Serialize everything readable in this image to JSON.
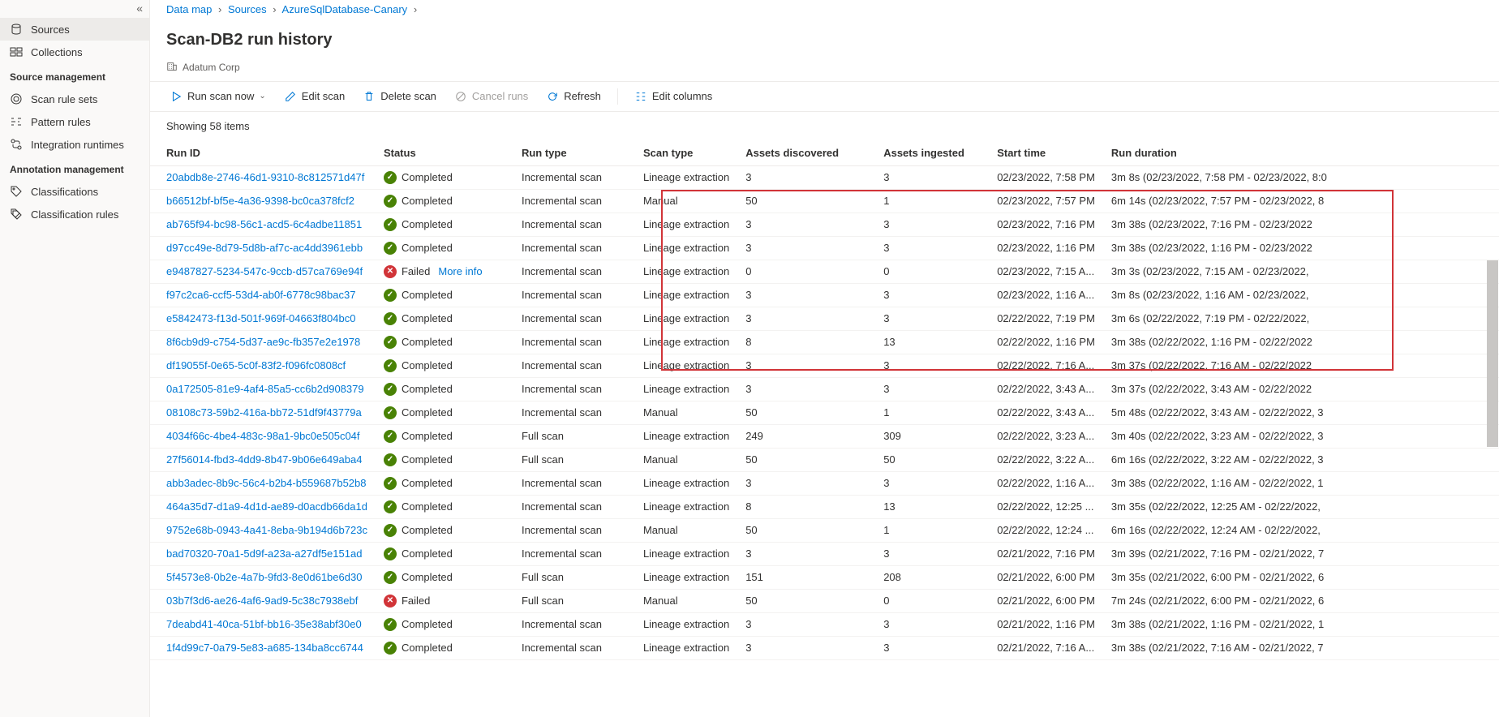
{
  "sidebar": {
    "collapse_glyph": "«",
    "items": [
      {
        "label": "Sources",
        "selected": true
      },
      {
        "label": "Collections",
        "selected": false
      }
    ],
    "section_source": "Source management",
    "source_items": [
      {
        "label": "Scan rule sets"
      },
      {
        "label": "Pattern rules"
      },
      {
        "label": "Integration runtimes"
      }
    ],
    "section_annot": "Annotation management",
    "annot_items": [
      {
        "label": "Classifications"
      },
      {
        "label": "Classification rules"
      }
    ]
  },
  "breadcrumb": {
    "items": [
      "Data map",
      "Sources",
      "AzureSqlDatabase-Canary"
    ]
  },
  "page": {
    "title": "Scan-DB2 run history",
    "tenant": "Adatum Corp"
  },
  "toolbar": {
    "run": "Run scan now",
    "edit": "Edit scan",
    "delete": "Delete scan",
    "cancel": "Cancel runs",
    "refresh": "Refresh",
    "editcols": "Edit columns"
  },
  "summary": "Showing 58 items",
  "columns": {
    "runid": "Run ID",
    "status": "Status",
    "runtype": "Run type",
    "scantype": "Scan type",
    "assets_disc": "Assets discovered",
    "assets_ing": "Assets ingested",
    "start": "Start time",
    "duration": "Run duration"
  },
  "status_labels": {
    "completed": "Completed",
    "failed": "Failed",
    "moreinfo": "More info"
  },
  "rows": [
    {
      "id": "20abdb8e-2746-46d1-9310-8c812571d47f",
      "status": "completed",
      "runtype": "Incremental scan",
      "scantype": "Lineage extraction",
      "disc": "3",
      "ing": "3",
      "start": "02/23/2022, 7:58 PM",
      "dur": "3m 8s (02/23/2022, 7:58 PM - 02/23/2022, 8:0"
    },
    {
      "id": "b66512bf-bf5e-4a36-9398-bc0ca378fcf2",
      "status": "completed",
      "runtype": "Incremental scan",
      "scantype": "Manual",
      "disc": "50",
      "ing": "1",
      "start": "02/23/2022, 7:57 PM",
      "dur": "6m 14s (02/23/2022, 7:57 PM - 02/23/2022, 8"
    },
    {
      "id": "ab765f94-bc98-56c1-acd5-6c4adbe11851",
      "status": "completed",
      "runtype": "Incremental scan",
      "scantype": "Lineage extraction",
      "disc": "3",
      "ing": "3",
      "start": "02/23/2022, 7:16 PM",
      "dur": "3m 38s (02/23/2022, 7:16 PM - 02/23/2022"
    },
    {
      "id": "d97cc49e-8d79-5d8b-af7c-ac4dd3961ebb",
      "status": "completed",
      "runtype": "Incremental scan",
      "scantype": "Lineage extraction",
      "disc": "3",
      "ing": "3",
      "start": "02/23/2022, 1:16 PM",
      "dur": "3m 38s (02/23/2022, 1:16 PM - 02/23/2022"
    },
    {
      "id": "e9487827-5234-547c-9ccb-d57ca769e94f",
      "status": "failed",
      "moreinfo": true,
      "runtype": "Incremental scan",
      "scantype": "Lineage extraction",
      "disc": "0",
      "ing": "0",
      "start": "02/23/2022, 7:15 A...",
      "dur": "3m 3s (02/23/2022, 7:15 AM - 02/23/2022,"
    },
    {
      "id": "f97c2ca6-ccf5-53d4-ab0f-6778c98bac37",
      "status": "completed",
      "runtype": "Incremental scan",
      "scantype": "Lineage extraction",
      "disc": "3",
      "ing": "3",
      "start": "02/23/2022, 1:16 A...",
      "dur": "3m 8s (02/23/2022, 1:16 AM - 02/23/2022,"
    },
    {
      "id": "e5842473-f13d-501f-969f-04663f804bc0",
      "status": "completed",
      "runtype": "Incremental scan",
      "scantype": "Lineage extraction",
      "disc": "3",
      "ing": "3",
      "start": "02/22/2022, 7:19 PM",
      "dur": "3m 6s (02/22/2022, 7:19 PM - 02/22/2022,"
    },
    {
      "id": "8f6cb9d9-c754-5d37-ae9c-fb357e2e1978",
      "status": "completed",
      "runtype": "Incremental scan",
      "scantype": "Lineage extraction",
      "disc": "8",
      "ing": "13",
      "start": "02/22/2022, 1:16 PM",
      "dur": "3m 38s (02/22/2022, 1:16 PM - 02/22/2022"
    },
    {
      "id": "df19055f-0e65-5c0f-83f2-f096fc0808cf",
      "status": "completed",
      "runtype": "Incremental scan",
      "scantype": "Lineage extraction",
      "disc": "3",
      "ing": "3",
      "start": "02/22/2022, 7:16 A...",
      "dur": "3m 37s (02/22/2022, 7:16 AM - 02/22/2022"
    },
    {
      "id": "0a172505-81e9-4af4-85a5-cc6b2d908379",
      "status": "completed",
      "runtype": "Incremental scan",
      "scantype": "Lineage extraction",
      "disc": "3",
      "ing": "3",
      "start": "02/22/2022, 3:43 A...",
      "dur": "3m 37s (02/22/2022, 3:43 AM - 02/22/2022"
    },
    {
      "id": "08108c73-59b2-416a-bb72-51df9f43779a",
      "status": "completed",
      "runtype": "Incremental scan",
      "scantype": "Manual",
      "disc": "50",
      "ing": "1",
      "start": "02/22/2022, 3:43 A...",
      "dur": "5m 48s (02/22/2022, 3:43 AM - 02/22/2022, 3"
    },
    {
      "id": "4034f66c-4be4-483c-98a1-9bc0e505c04f",
      "status": "completed",
      "runtype": "Full scan",
      "scantype": "Lineage extraction",
      "disc": "249",
      "ing": "309",
      "start": "02/22/2022, 3:23 A...",
      "dur": "3m 40s (02/22/2022, 3:23 AM - 02/22/2022, 3"
    },
    {
      "id": "27f56014-fbd3-4dd9-8b47-9b06e649aba4",
      "status": "completed",
      "runtype": "Full scan",
      "scantype": "Manual",
      "disc": "50",
      "ing": "50",
      "start": "02/22/2022, 3:22 A...",
      "dur": "6m 16s (02/22/2022, 3:22 AM - 02/22/2022, 3"
    },
    {
      "id": "abb3adec-8b9c-56c4-b2b4-b559687b52b8",
      "status": "completed",
      "runtype": "Incremental scan",
      "scantype": "Lineage extraction",
      "disc": "3",
      "ing": "3",
      "start": "02/22/2022, 1:16 A...",
      "dur": "3m 38s (02/22/2022, 1:16 AM - 02/22/2022, 1"
    },
    {
      "id": "464a35d7-d1a9-4d1d-ae89-d0acdb66da1d",
      "status": "completed",
      "runtype": "Incremental scan",
      "scantype": "Lineage extraction",
      "disc": "8",
      "ing": "13",
      "start": "02/22/2022, 12:25 ...",
      "dur": "3m 35s (02/22/2022, 12:25 AM - 02/22/2022,"
    },
    {
      "id": "9752e68b-0943-4a41-8eba-9b194d6b723c",
      "status": "completed",
      "runtype": "Incremental scan",
      "scantype": "Manual",
      "disc": "50",
      "ing": "1",
      "start": "02/22/2022, 12:24 ...",
      "dur": "6m 16s (02/22/2022, 12:24 AM - 02/22/2022,"
    },
    {
      "id": "bad70320-70a1-5d9f-a23a-a27df5e151ad",
      "status": "completed",
      "runtype": "Incremental scan",
      "scantype": "Lineage extraction",
      "disc": "3",
      "ing": "3",
      "start": "02/21/2022, 7:16 PM",
      "dur": "3m 39s (02/21/2022, 7:16 PM - 02/21/2022, 7"
    },
    {
      "id": "5f4573e8-0b2e-4a7b-9fd3-8e0d61be6d30",
      "status": "completed",
      "runtype": "Full scan",
      "scantype": "Lineage extraction",
      "disc": "151",
      "ing": "208",
      "start": "02/21/2022, 6:00 PM",
      "dur": "3m 35s (02/21/2022, 6:00 PM - 02/21/2022, 6"
    },
    {
      "id": "03b7f3d6-ae26-4af6-9ad9-5c38c7938ebf",
      "status": "failed",
      "runtype": "Full scan",
      "scantype": "Manual",
      "disc": "50",
      "ing": "0",
      "start": "02/21/2022, 6:00 PM",
      "dur": "7m 24s (02/21/2022, 6:00 PM - 02/21/2022, 6"
    },
    {
      "id": "7deabd41-40ca-51bf-bb16-35e38abf30e0",
      "status": "completed",
      "runtype": "Incremental scan",
      "scantype": "Lineage extraction",
      "disc": "3",
      "ing": "3",
      "start": "02/21/2022, 1:16 PM",
      "dur": "3m 38s (02/21/2022, 1:16 PM - 02/21/2022, 1"
    },
    {
      "id": "1f4d99c7-0a79-5e83-a685-134ba8cc6744",
      "status": "completed",
      "runtype": "Incremental scan",
      "scantype": "Lineage extraction",
      "disc": "3",
      "ing": "3",
      "start": "02/21/2022, 7:16 A...",
      "dur": "3m 38s (02/21/2022, 7:16 AM - 02/21/2022, 7"
    }
  ]
}
